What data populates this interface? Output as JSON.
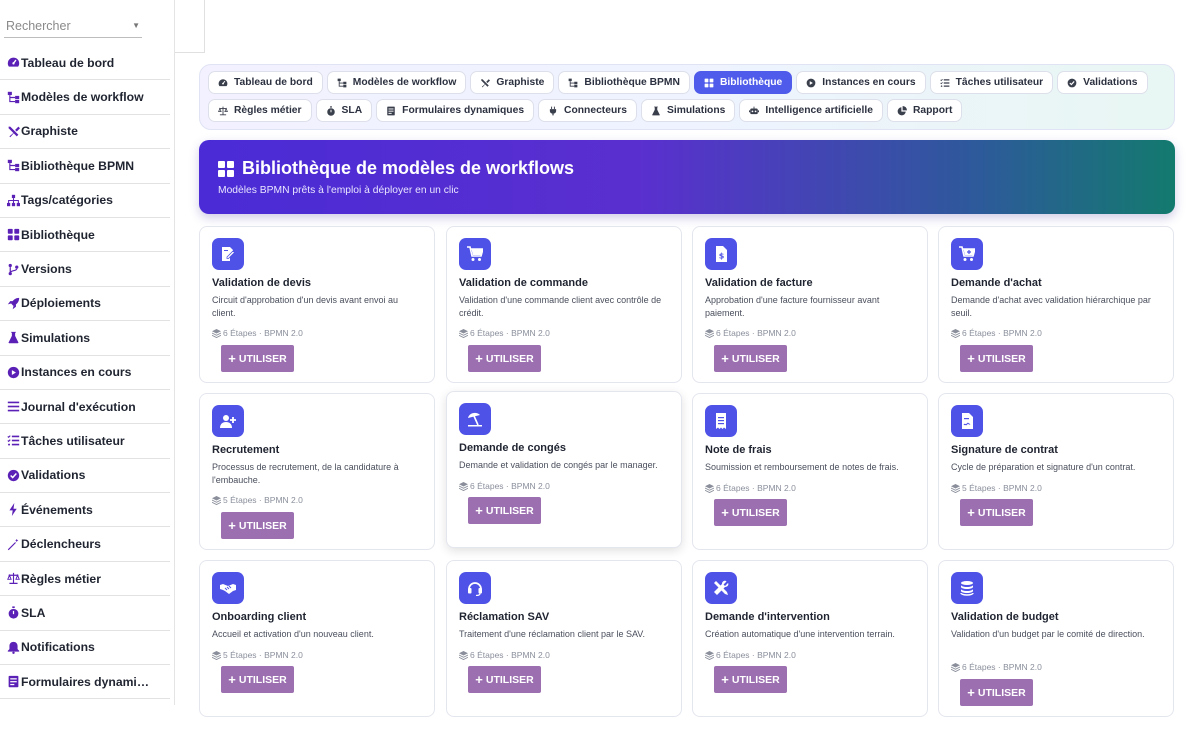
{
  "search": {
    "placeholder": "Rechercher"
  },
  "sidebar": {
    "items": [
      {
        "label": "Tableau de bord",
        "icon": "gauge-icon"
      },
      {
        "label": "Modèles de workflow",
        "icon": "sitemap-icon"
      },
      {
        "label": "Graphiste",
        "icon": "tools-icon"
      },
      {
        "label": "Bibliothèque BPMN",
        "icon": "sitemap-icon"
      },
      {
        "label": "Tags/catégories",
        "icon": "hierarchy-icon"
      },
      {
        "label": "Bibliothèque",
        "icon": "grid-icon"
      },
      {
        "label": "Versions",
        "icon": "branch-icon"
      },
      {
        "label": "Déploiements",
        "icon": "rocket-icon"
      },
      {
        "label": "Simulations",
        "icon": "flask-icon"
      },
      {
        "label": "Instances en cours",
        "icon": "play-circle-icon"
      },
      {
        "label": "Journal d'exécution",
        "icon": "list-icon"
      },
      {
        "label": "Tâches utilisateur",
        "icon": "tasks-icon"
      },
      {
        "label": "Validations",
        "icon": "check-circle-icon"
      },
      {
        "label": "Événements",
        "icon": "bolt-icon"
      },
      {
        "label": "Déclencheurs",
        "icon": "wand-icon"
      },
      {
        "label": "Règles métier",
        "icon": "scale-icon"
      },
      {
        "label": "SLA",
        "icon": "stopwatch-icon"
      },
      {
        "label": "Notifications",
        "icon": "bell-icon"
      },
      {
        "label": "Formulaires dynamiques",
        "display": "Formulaires dynami…",
        "icon": "form-icon"
      }
    ]
  },
  "nav": {
    "row1": [
      {
        "label": "Tableau de bord",
        "icon": "gauge-icon"
      },
      {
        "label": "Modèles de workflow",
        "icon": "sitemap-icon"
      },
      {
        "label": "Graphiste",
        "icon": "tools-icon"
      },
      {
        "label": "Bibliothèque BPMN",
        "icon": "sitemap-icon"
      },
      {
        "label": "Bibliothèque",
        "icon": "grid-icon",
        "active": true
      },
      {
        "label": "Instances en cours",
        "icon": "play-circle-icon"
      },
      {
        "label": "Tâches utilisateur",
        "icon": "tasks-icon"
      },
      {
        "label": "Validations",
        "icon": "check-circle-icon"
      }
    ],
    "row2": [
      {
        "label": "Règles métier",
        "icon": "scale-icon"
      },
      {
        "label": "SLA",
        "icon": "stopwatch-icon"
      },
      {
        "label": "Formulaires dynamiques",
        "icon": "form-icon"
      },
      {
        "label": "Connecteurs",
        "icon": "plug-icon"
      },
      {
        "label": "Simulations",
        "icon": "flask-icon"
      },
      {
        "label": "Intelligence artificielle",
        "icon": "robot-icon"
      },
      {
        "label": "Rapport",
        "icon": "pie-icon"
      }
    ]
  },
  "hero": {
    "title": "Bibliothèque de modèles de workflows",
    "subtitle": "Modèles BPMN prêts à l'emploi à déployer en un clic"
  },
  "cards": [
    {
      "title": "Validation de devis",
      "desc": "Circuit d'approbation d'un devis avant envoi au client.",
      "meta": "6 Étapes · BPMN 2.0",
      "icon": "file-signature-icon"
    },
    {
      "title": "Validation de commande",
      "desc": "Validation d'une commande client avec contrôle de crédit.",
      "meta": "6 Étapes · BPMN 2.0",
      "icon": "cart-icon"
    },
    {
      "title": "Validation de facture",
      "desc": "Approbation d'une facture fournisseur avant paiement.",
      "meta": "6 Étapes · BPMN 2.0",
      "icon": "invoice-icon"
    },
    {
      "title": "Demande d'achat",
      "desc": "Demande d'achat avec validation hiérarchique par seuil.",
      "meta": "6 Étapes · BPMN 2.0",
      "icon": "cart-plus-icon"
    },
    {
      "title": "Recrutement",
      "desc": "Processus de recrutement, de la candidature à l'embauche.",
      "meta": "5 Étapes · BPMN 2.0",
      "icon": "user-plus-icon"
    },
    {
      "title": "Demande de congés",
      "desc": "Demande et validation de congés par le manager.",
      "meta": "6 Étapes · BPMN 2.0",
      "icon": "umbrella-beach-icon",
      "raised": true
    },
    {
      "title": "Note de frais",
      "desc": "Soumission et remboursement de notes de frais.",
      "meta": "6 Étapes · BPMN 2.0",
      "icon": "receipt-icon"
    },
    {
      "title": "Signature de contrat",
      "desc": "Cycle de préparation et signature d'un contrat.",
      "meta": "5 Étapes · BPMN 2.0",
      "icon": "contract-icon"
    },
    {
      "title": "Onboarding client",
      "desc": "Accueil et activation d'un nouveau client.",
      "meta": "5 Étapes · BPMN 2.0",
      "icon": "handshake-icon"
    },
    {
      "title": "Réclamation SAV",
      "desc": "Traitement d'une réclamation client par le SAV.",
      "meta": "6 Étapes · BPMN 2.0",
      "icon": "headset-icon"
    },
    {
      "title": "Demande d'intervention",
      "desc": "Création automatique d'une intervention terrain.",
      "meta": "6 Étapes · BPMN 2.0",
      "icon": "tools-icon"
    },
    {
      "title": "Validation de budget",
      "desc": "Validation d'un budget par le comité de direction.",
      "meta": "6 Étapes · BPMN 2.0",
      "icon": "coins-icon"
    }
  ],
  "buttons": {
    "use_label": "UTILISER"
  },
  "colors": {
    "accent": "#4f5bea",
    "icon_bg": "#4f52e6",
    "sidebar_icon": "#5b21b6",
    "button": "#9b6fb0"
  }
}
